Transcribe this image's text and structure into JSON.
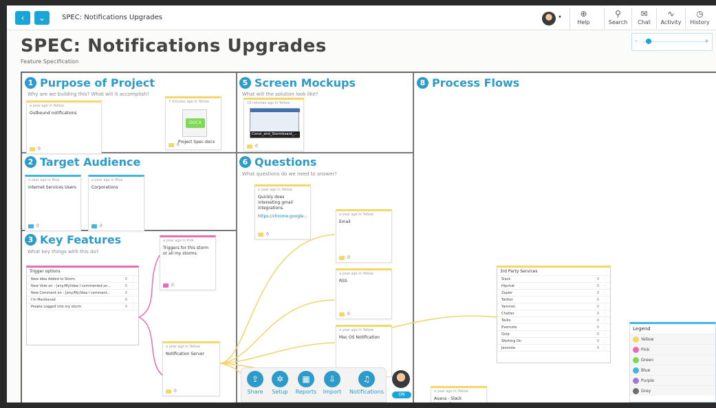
{
  "topbar": {
    "doc_title": "SPEC: Notifications Upgrades",
    "tools": [
      {
        "label": "Help",
        "icon": "help-icon",
        "glyph": "⊕"
      },
      {
        "label": "Search",
        "icon": "search-icon",
        "glyph": "⚲"
      },
      {
        "label": "Chat",
        "icon": "chat-icon",
        "glyph": "✉"
      },
      {
        "label": "Activity",
        "icon": "activity-icon",
        "glyph": "∿"
      },
      {
        "label": "History",
        "icon": "history-icon",
        "glyph": "◷"
      }
    ]
  },
  "page": {
    "title": "SPEC: Notifications Upgrades",
    "subtitle": "Feature Specification"
  },
  "sections": {
    "purpose": {
      "num": "1",
      "title": "Purpose of Project",
      "hint": "Why are we building this? What will it accomplish?"
    },
    "mockups": {
      "num": "5",
      "title": "Screen Mockups",
      "hint": "What will the solution look like?"
    },
    "flows": {
      "num": "8",
      "title": "Process Flows"
    },
    "audience": {
      "num": "2",
      "title": "Target Audience"
    },
    "questions": {
      "num": "6",
      "title": "Questions",
      "hint": "What questions do we need to answer?"
    },
    "features": {
      "num": "3",
      "title": "Key Features",
      "hint": "What key things with this do?"
    }
  },
  "cards": {
    "outbound": {
      "meta": "a year ago in Yellow",
      "body": "Outbound notifications",
      "count": "0"
    },
    "specdoc": {
      "meta": "7 minutes ago in Yellow",
      "file": "DOCX",
      "body": "Project Spec.docx",
      "count": "0"
    },
    "mockup": {
      "meta": "19 minutes ago in Yellow",
      "cap": "Conor_and_Stormboard_...",
      "count": "0"
    },
    "internet": {
      "meta": "a year ago in Blue",
      "body": "Internet Services Users",
      "count": "0"
    },
    "corps": {
      "meta": "a year ago in Blue",
      "body": "Corporations",
      "count": "0"
    },
    "question": {
      "meta": "a year ago in Yellow",
      "body": "Quickly does interesting gmail integrations.",
      "link": "https://chrome.google...",
      "count": "0"
    },
    "triggers": {
      "meta": "a year ago in Pink",
      "body": "Triggers for this storm or all my storms.",
      "count": "0"
    },
    "email": {
      "meta": "a year ago in Yellow",
      "body": "Email",
      "count": "0"
    },
    "rss": {
      "meta": "a year ago in Yellow",
      "body": "RSS",
      "count": "0"
    },
    "macos": {
      "meta": "a year ago in Yellow",
      "body": "Mac OS Notification",
      "count": "0"
    },
    "notifserver": {
      "meta": "a year ago in Yellow",
      "body": "Notification Server",
      "count": "0"
    },
    "asana": {
      "meta": "a year ago in Yellow",
      "body": "Asana - Slack Integration"
    }
  },
  "trigger_list": {
    "title": "Trigger options",
    "rows": [
      {
        "label": "New Idea Added to Storm",
        "count": "0"
      },
      {
        "label": "New Vote on - [any/My/Idea I commented on...",
        "count": "0"
      },
      {
        "label": "New Comment on - [any/My/Idea I comment...",
        "count": "0"
      },
      {
        "label": "I'm Mentioned",
        "count": "0"
      },
      {
        "label": "People Logged into my storm",
        "count": "0"
      }
    ]
  },
  "services_list": {
    "title": "3rd Party Services",
    "rows": [
      {
        "label": "Slack",
        "count": "0"
      },
      {
        "label": "Hipchat",
        "count": "0"
      },
      {
        "label": "Zapier",
        "count": "0"
      },
      {
        "label": "Twitter",
        "count": "0"
      },
      {
        "label": "Yammer",
        "count": "0"
      },
      {
        "label": "Chatter",
        "count": "0"
      },
      {
        "label": "Twilio",
        "count": "0"
      },
      {
        "label": "Evernote",
        "count": "0"
      },
      {
        "label": "Quip",
        "count": "0"
      },
      {
        "label": "Working On",
        "count": "0"
      },
      {
        "label": "Jeconda",
        "count": "0"
      }
    ]
  },
  "bottom": {
    "buttons": [
      {
        "label": "Share",
        "icon": "share-icon",
        "glyph": "⇪"
      },
      {
        "label": "Setup",
        "icon": "setup-icon",
        "glyph": "✲"
      },
      {
        "label": "Reports",
        "icon": "reports-icon",
        "glyph": "▦"
      },
      {
        "label": "Import",
        "icon": "import-icon",
        "glyph": "⇩"
      },
      {
        "label": "Notifications",
        "icon": "bell-icon",
        "glyph": "♫"
      }
    ],
    "toggle": "ON"
  },
  "legend": {
    "title": "Legend",
    "items": [
      {
        "label": "Yellow",
        "color": "#f5d766"
      },
      {
        "label": "Pink",
        "color": "#e86ab8"
      },
      {
        "label": "Green",
        "color": "#7ed957"
      },
      {
        "label": "Blue",
        "color": "#3fb5e0"
      },
      {
        "label": "Purple",
        "color": "#a07ad8"
      },
      {
        "label": "Grey",
        "color": "#6d6d6d"
      }
    ]
  }
}
